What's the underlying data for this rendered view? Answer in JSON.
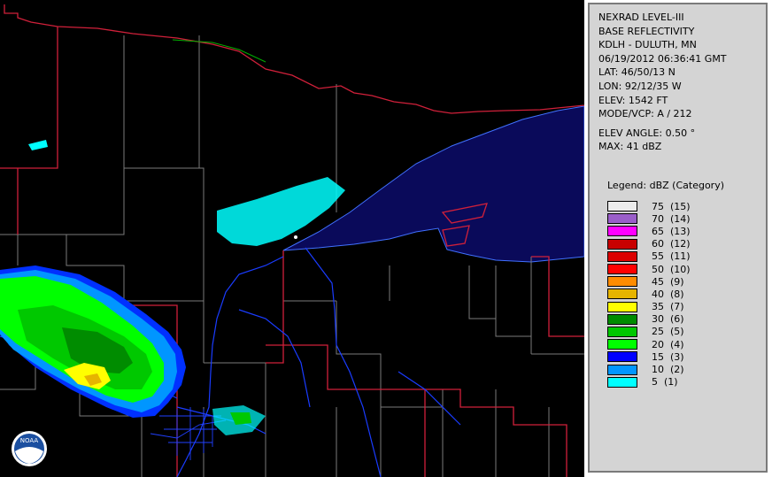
{
  "header": {
    "product": "NEXRAD LEVEL-III",
    "type": "BASE REFLECTIVITY",
    "station": "KDLH - DULUTH, MN",
    "datetime": "06/19/2012 06:36:41 GMT",
    "lat": "LAT: 46/50/13 N",
    "lon": "LON: 92/12/35 W",
    "elev": "ELEV: 1542 FT",
    "mode": "MODE/VCP: A / 212",
    "elev_angle": "ELEV ANGLE: 0.50 °",
    "max": "MAX: 41 dBZ"
  },
  "legend": {
    "title": "Legend: dBZ (Category)",
    "entries": [
      {
        "label": "75  (15)",
        "color": "#ececec"
      },
      {
        "label": "70  (14)",
        "color": "#9a5fc9"
      },
      {
        "label": "65  (13)",
        "color": "#ff00ff"
      },
      {
        "label": "60  (12)",
        "color": "#c80000"
      },
      {
        "label": "55  (11)",
        "color": "#dc0000"
      },
      {
        "label": "50  (10)",
        "color": "#ff0000"
      },
      {
        "label": "45  (9)",
        "color": "#ff8c00"
      },
      {
        "label": "40  (8)",
        "color": "#e6b400"
      },
      {
        "label": "35  (7)",
        "color": "#ffff00"
      },
      {
        "label": "30  (6)",
        "color": "#008c00"
      },
      {
        "label": "25  (5)",
        "color": "#00c800"
      },
      {
        "label": "20  (4)",
        "color": "#00ff00"
      },
      {
        "label": "15  (3)",
        "color": "#0000ff"
      },
      {
        "label": "10  (2)",
        "color": "#0096ff"
      },
      {
        "label": "5  (1)",
        "color": "#00ffff"
      }
    ]
  },
  "colors": {
    "background": "#000000",
    "lake": "#0a0a5a",
    "state_border": "#d0203a",
    "county_border": "#7a7a7a",
    "rivers": "#1a3cff",
    "panel": "#d4d4d4"
  },
  "logo": {
    "text": "NOAA"
  }
}
